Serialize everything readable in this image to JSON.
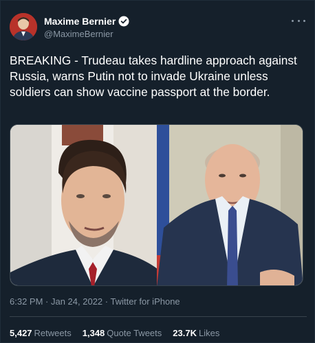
{
  "account": {
    "display_name": "Maxime Bernier",
    "handle": "@MaximeBernier",
    "verified": true,
    "avatar_icon": "avatar"
  },
  "tweet": {
    "text": "BREAKING - Trudeau takes hardline approach against Russia, warns Putin not to invade Ukraine unless soldiers can show vaccine passport at the border."
  },
  "meta": {
    "time": "6:32 PM",
    "separator1": " · ",
    "date": "Jan 24, 2022",
    "separator2": " · ",
    "source": "Twitter for iPhone"
  },
  "stats": {
    "retweets_count": "5,427",
    "retweets_label": "Retweets",
    "quotes_count": "1,348",
    "quotes_label": "Quote Tweets",
    "likes_count": "23.7K",
    "likes_label": "Likes"
  },
  "colors": {
    "background": "#15202b",
    "secondary_text": "#8b98a5",
    "verified_blue": "#1d9bf0",
    "divider": "#38444d"
  },
  "icons": {
    "more": "more-horizontal-icon",
    "verified": "verified-badge-icon"
  }
}
